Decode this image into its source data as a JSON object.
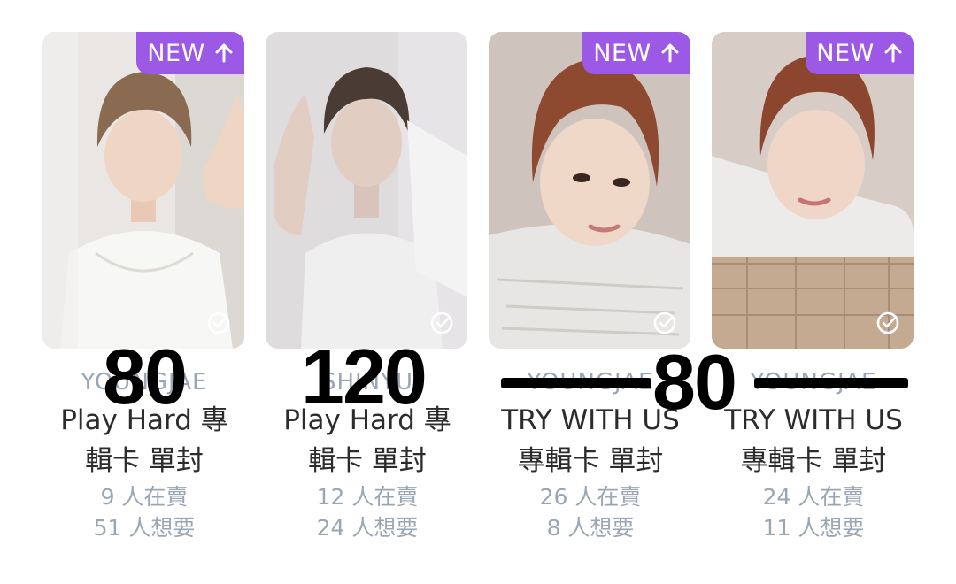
{
  "cards": [
    {
      "artist": "YOUNGJAE",
      "title_line1": "Play Hard 專",
      "title_line2": "輯卡 單封",
      "sellers": "9 人在賣",
      "wanters": "51 人想要",
      "is_new": true
    },
    {
      "artist": "SHINYU",
      "title_line1": "Play Hard 專",
      "title_line2": "輯卡 單封",
      "sellers": "12 人在賣",
      "wanters": "24 人想要",
      "is_new": false
    },
    {
      "artist": "YOUNGJAE",
      "title_line1": "TRY WITH US",
      "title_line2": "專輯卡 單封",
      "sellers": "26 人在賣",
      "wanters": "8 人想要",
      "is_new": true
    },
    {
      "artist": "YOUNGJAE",
      "title_line1": "TRY WITH US",
      "title_line2": "專輯卡 單封",
      "sellers": "24 人在賣",
      "wanters": "11 人想要",
      "is_new": true
    }
  ],
  "badge_label": "NEW",
  "overlay": {
    "price_1": "80",
    "price_2": "120",
    "price_3": "80"
  },
  "colors": {
    "badge": "#9b59e6",
    "meta_text": "#9aa6b4",
    "title_text": "#2c2c2c"
  },
  "icons": {
    "badge": "arrow-up-icon",
    "photo": "check-circle-icon"
  }
}
